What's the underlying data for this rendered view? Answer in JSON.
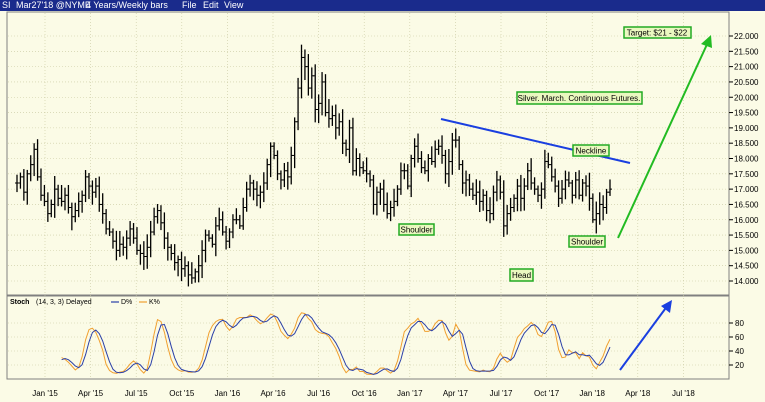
{
  "window": {
    "symbol": "SI",
    "quote": "Mar27'18 @NYME",
    "chart_spec": "4 Years/Weekly bars",
    "menu": [
      "File",
      "Edit",
      "View"
    ]
  },
  "colors": {
    "background": "#fbfbe6",
    "titlebar": "#1a2b8c",
    "bars": "#000000",
    "neckline": "#1a3fe0",
    "target_arrow": "#22bb22",
    "stoch_arrow": "#1a3fe0",
    "d_line": "#2a3fa8",
    "k_line": "#f0a030",
    "label_border": "#22aa22"
  },
  "annotations": {
    "target": "Target: $21 - $22",
    "title": "Silver. March. Continuous Futures.",
    "neckline": "Neckline",
    "left_shoulder": "Shoulder",
    "head": "Head",
    "right_shoulder": "Shoulder"
  },
  "chart_data": [
    {
      "type": "bar",
      "subtype": "ohlc",
      "title": "Silver. March. Continuous Futures.",
      "x_ticks": [
        "Jan '15",
        "Apr '15",
        "Jul '15",
        "Oct '15",
        "Jan '16",
        "Apr '16",
        "Jul '16",
        "Oct '16",
        "Jan '17",
        "Apr '17",
        "Jul '17",
        "Oct '17",
        "Jan '18",
        "Apr '18",
        "Jul '18"
      ],
      "y_ticks": [
        "22.000",
        "21.500",
        "21.000",
        "20.500",
        "20.000",
        "19.500",
        "19.000",
        "18.500",
        "18.000",
        "17.500",
        "17.000",
        "16.500",
        "16.000",
        "15.500",
        "15.000",
        "14.500",
        "14.000"
      ],
      "ylim": [
        13.8,
        22.5
      ],
      "close_series": [
        17.2,
        17.4,
        16.9,
        17.5,
        17.8,
        18.3,
        17.4,
        16.8,
        16.6,
        16.2,
        16.5,
        17.0,
        16.7,
        16.6,
        16.8,
        16.4,
        16.1,
        16.3,
        16.6,
        16.8,
        17.4,
        17.1,
        16.9,
        17.1,
        16.5,
        16.2,
        15.7,
        15.6,
        15.3,
        15.0,
        15.2,
        15.1,
        15.4,
        15.7,
        15.4,
        15.0,
        14.9,
        14.8,
        15.1,
        15.6,
        16.1,
        16.3,
        15.9,
        15.4,
        15.1,
        14.9,
        14.6,
        14.7,
        14.4,
        14.5,
        14.2,
        14.1,
        14.3,
        14.5,
        15.0,
        15.5,
        15.4,
        15.2,
        15.8,
        16.0,
        15.6,
        15.3,
        15.6,
        16.0,
        16.0,
        15.8,
        16.4,
        17.0,
        17.2,
        17.0,
        16.8,
        16.9,
        17.2,
        17.8,
        18.4,
        18.1,
        17.5,
        17.3,
        17.6,
        17.4,
        18.1,
        19.2,
        20.3,
        21.3,
        21.0,
        20.3,
        20.7,
        19.6,
        19.8,
        20.5,
        19.5,
        19.3,
        19.4,
        19.0,
        19.2,
        18.5,
        18.3,
        19.0,
        17.6,
        18.0,
        17.7,
        17.6,
        17.5,
        17.3,
        16.5,
        16.9,
        17.0,
        16.5,
        16.2,
        16.4,
        16.6,
        17.0,
        17.6,
        17.6,
        17.1,
        18.0,
        18.4,
        18.0,
        17.7,
        17.6,
        18.0,
        17.9,
        18.3,
        18.4,
        18.1,
        17.5,
        17.9,
        18.6,
        18.6,
        17.8,
        17.2,
        17.3,
        17.0,
        16.8,
        16.9,
        16.6,
        16.8,
        16.3,
        16.2,
        16.9,
        17.3,
        16.9,
        15.8,
        16.2,
        16.4,
        16.7,
        17.1,
        16.7,
        17.1,
        17.6,
        17.2,
        17.0,
        16.8,
        17.0,
        17.9,
        17.8,
        17.4,
        17.1,
        16.7,
        17.0,
        17.3,
        17.2,
        16.8,
        17.3,
        16.8,
        17.2,
        17.1,
        16.7,
        16.0,
        16.2,
        16.5,
        16.4,
        16.9,
        17.0
      ]
    },
    {
      "type": "line",
      "title": "Stoch",
      "params": "(14, 3, 3) Delayed",
      "legend": [
        "D%",
        "K%"
      ],
      "y_ticks": [
        "80",
        "60",
        "40",
        "20"
      ],
      "ylim": [
        0,
        100
      ]
    }
  ]
}
